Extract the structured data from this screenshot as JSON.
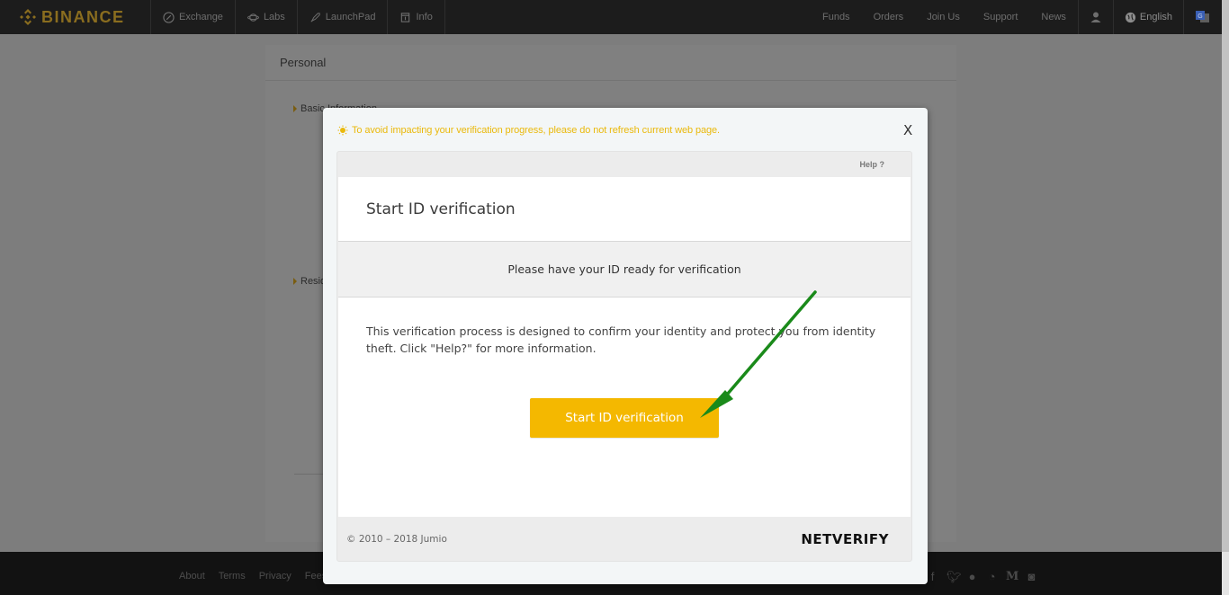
{
  "nav": {
    "brand": "BINANCE",
    "left_items": [
      {
        "label": "Exchange",
        "icon": "exchange-icon"
      },
      {
        "label": "Labs",
        "icon": "labs-planet-icon"
      },
      {
        "label": "LaunchPad",
        "icon": "rocket-icon"
      },
      {
        "label": "Info",
        "icon": "info-book-icon"
      }
    ],
    "right_links": [
      "Funds",
      "Orders",
      "Join Us",
      "Support",
      "News"
    ],
    "user_icon": "user-icon",
    "language": "English",
    "translate_icon": "google-translate-icon"
  },
  "background_page": {
    "card_title": "Personal",
    "section_basic": "Basic Information",
    "section_residence": "Residential Address"
  },
  "modal": {
    "warning": "To avoid impacting your verification progress, please do not refresh current web page.",
    "close_label": "X",
    "help_label": "Help ?",
    "title": "Start ID verification",
    "banner": "Please have your ID ready for verification",
    "description": "This verification process is designed to confirm your identity and protect you from identity theft. Click \"Help?\" for more information.",
    "start_button": "Start ID verification",
    "copyright": "© 2010 – 2018 Jumio",
    "brand": "NETVERIFY"
  },
  "footer": {
    "links": [
      "About",
      "Terms",
      "Privacy",
      "Fees"
    ],
    "social": [
      "facebook-icon",
      "twitter-icon",
      "reddit-icon",
      "steemit-icon",
      "medium-icon",
      "instagram-icon"
    ]
  },
  "colors": {
    "brand_gold": "#8a6d1f",
    "warning_yellow": "#eab90c",
    "button_yellow": "#f4b800",
    "annotation_arrow": "#1a8a1a"
  }
}
